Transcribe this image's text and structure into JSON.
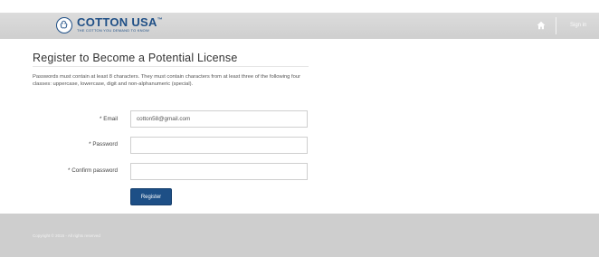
{
  "header": {
    "logo_text": "COTTON USA",
    "logo_trademark": "™",
    "logo_tagline": "THE COTTON YOU DEMAND TO KNOW",
    "home_icon": "home-icon",
    "signin_label": "Sign in",
    "background_color": "#d6d6d6",
    "brand_color": "#1f4f86"
  },
  "main": {
    "title": "Register to Become a Potential License",
    "instructions": "Passwords must contain at least 8 characters. They must contain characters from at least three of the following four classes: uppercase, lowercase, digit and non-alphanumeric (special).",
    "form": {
      "required_marker": "*",
      "email_label": "Email",
      "email_value": "cotton58@gmail.com",
      "password_label": "Password",
      "password_value": "",
      "confirm_label": "Confirm password",
      "confirm_value": "",
      "register_label": "Register",
      "button_color": "#1d4f86"
    }
  },
  "footer": {
    "copyright": "Copyright © 2015 - All rights reserved",
    "background_color": "#cecece"
  }
}
